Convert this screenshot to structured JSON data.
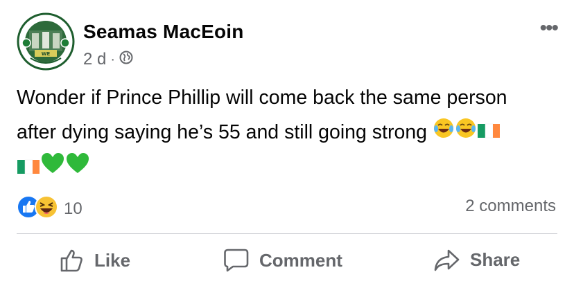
{
  "post": {
    "author": "Seamas MacEoin",
    "time": "2 d",
    "separator": "·",
    "privacy_icon": "globe-icon",
    "more_icon": "•••",
    "avatar": {
      "top_text": "QUADRUPLE TREBLE WINNERS",
      "badge_text": "WE",
      "bottom_text": "QUADRUPLE IN A ROW WINNERS",
      "accent": "#1e7d36"
    },
    "text_line1": "Wonder if Prince Phillip will come back the same person",
    "text_line2": "after dying saying he’s 55 and still going strong",
    "text_emojis": [
      "laughing-crying-emoji",
      "laughing-crying-emoji",
      "irish-flag-emoji",
      "irish-flag-emoji",
      "green-heart-emoji",
      "green-heart-emoji"
    ]
  },
  "reactions": {
    "icons": [
      "like-reaction-icon",
      "haha-reaction-icon"
    ],
    "count": "10",
    "comments": "2 comments"
  },
  "actions": {
    "like": "Like",
    "comment": "Comment",
    "share": "Share"
  },
  "colors": {
    "text": "#050505",
    "secondary": "#65676b",
    "like_blue": "#1877f2",
    "divider": "#ced0d4",
    "heart_green": "#2fb93a",
    "flag_green": "#169b62",
    "flag_orange": "#ff883e"
  }
}
